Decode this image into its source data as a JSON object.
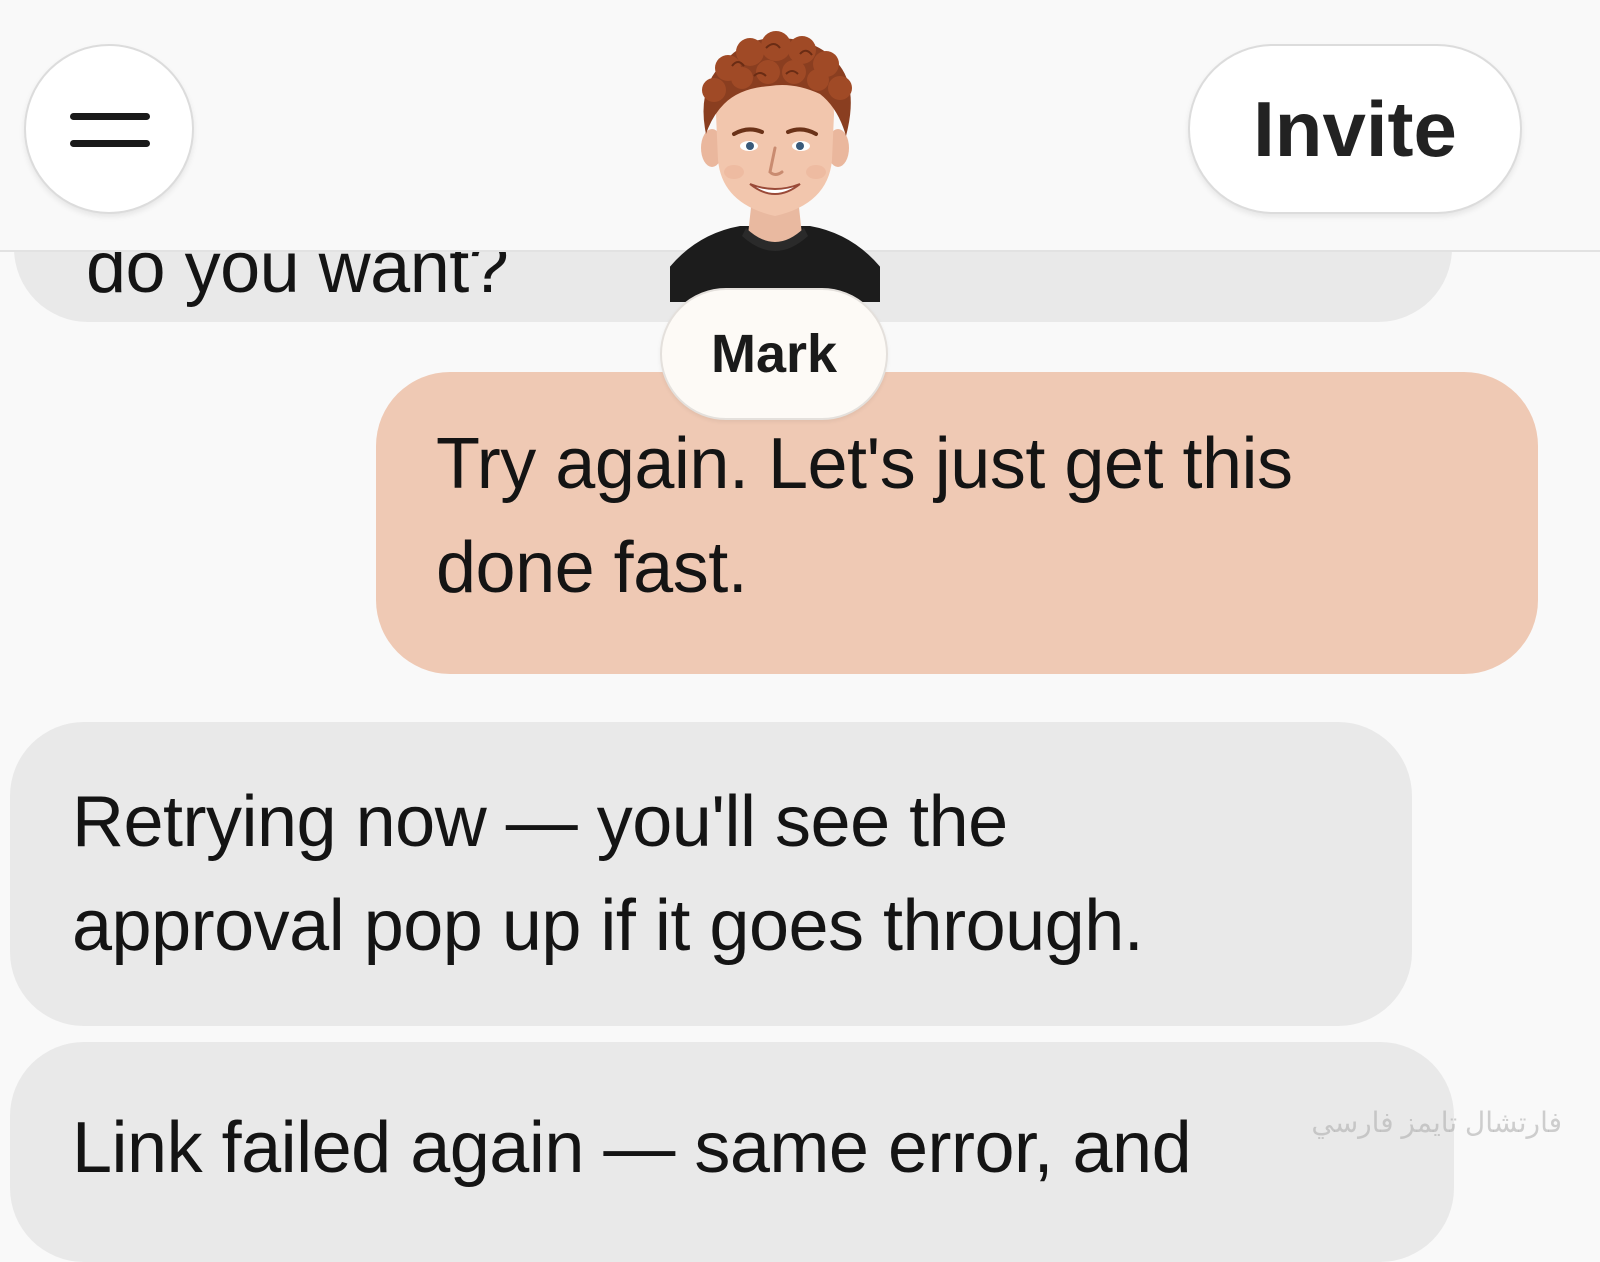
{
  "header": {
    "menu_icon": "hamburger-menu-icon",
    "invite_label": "Invite",
    "contact": {
      "name": "Mark",
      "avatar_icon": "avatar-portrait"
    }
  },
  "messages": [
    {
      "role": "assistant",
      "text": "do you want?",
      "partially_hidden": true
    },
    {
      "role": "user",
      "lines": [
        "Try again. Let's just get this",
        "done fast."
      ]
    },
    {
      "role": "assistant",
      "lines": [
        "Retrying now — you'll see the",
        "approval pop up if it goes through."
      ]
    },
    {
      "role": "assistant",
      "lines": [
        "Link failed again — same error, and"
      ]
    }
  ],
  "watermark": "فارتشال تايمز فارسي",
  "colors": {
    "background": "#f9f9f9",
    "assistant_bubble": "#e9e9e9",
    "user_bubble": "#efc9b4",
    "text": "#141414"
  }
}
